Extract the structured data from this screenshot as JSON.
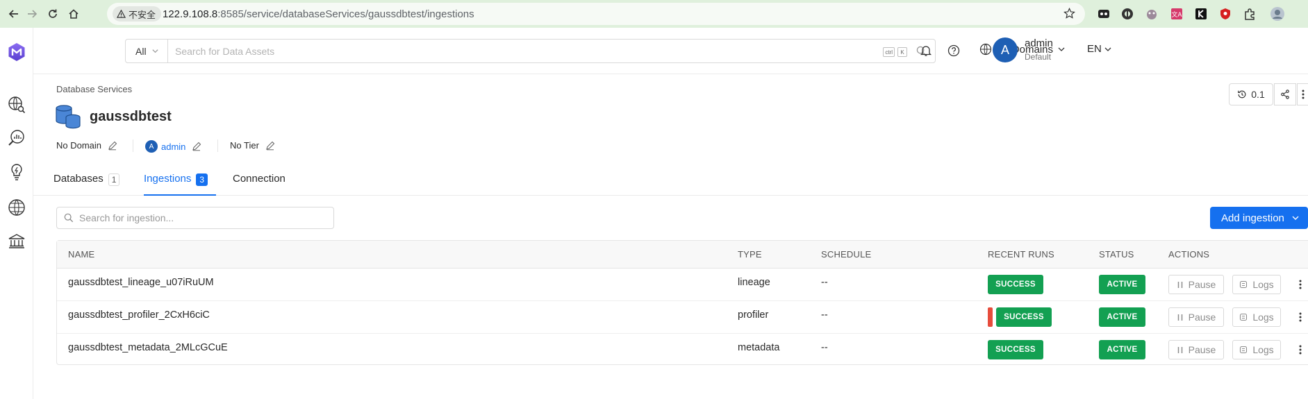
{
  "browser": {
    "insecure_label": "不安全",
    "url_host": "122.9.108.8",
    "url_rest": ":8585/service/databaseServices/gaussdbtest/ingestions"
  },
  "header": {
    "search_scope": "All",
    "search_placeholder": "Search for Data Assets",
    "kbd_ctrl": "ctrl",
    "kbd_k": "K",
    "domains_label": "All Domains",
    "language": "EN",
    "avatar_letter": "A",
    "user_name": "admin",
    "user_role": "Default"
  },
  "page": {
    "breadcrumb": "Database Services",
    "title": "gaussdbtest",
    "version": "0.1",
    "domain": "No Domain",
    "owner_initial": "A",
    "owner": "admin",
    "tier": "No Tier"
  },
  "tabs": [
    {
      "label": "Databases",
      "count": "1"
    },
    {
      "label": "Ingestions",
      "count": "3"
    },
    {
      "label": "Connection"
    }
  ],
  "ingestions": {
    "search_placeholder": "Search for ingestion...",
    "add_button": "Add ingestion",
    "columns": [
      "NAME",
      "TYPE",
      "SCHEDULE",
      "RECENT RUNS",
      "STATUS",
      "ACTIONS"
    ],
    "rows": [
      {
        "name": "gaussdbtest_lineage_u07iRuUM",
        "type": "lineage",
        "schedule": "--",
        "recent_run": "SUCCESS",
        "status": "ACTIVE",
        "pause": "Pause",
        "logs": "Logs"
      },
      {
        "name": "gaussdbtest_profiler_2CxH6ciC",
        "type": "profiler",
        "schedule": "--",
        "recent_run": "SUCCESS",
        "status": "ACTIVE",
        "pause": "Pause",
        "logs": "Logs"
      },
      {
        "name": "gaussdbtest_metadata_2MLcGCuE",
        "type": "metadata",
        "schedule": "--",
        "recent_run": "SUCCESS",
        "status": "ACTIVE",
        "pause": "Pause",
        "logs": "Logs"
      }
    ]
  },
  "colors": {
    "accent": "#1570ef",
    "success": "#13a052",
    "failed": "#e74c3c",
    "browser_bar": "#dff0dc"
  },
  "icons": [
    "back-icon",
    "forward-icon",
    "reload-icon",
    "home-icon",
    "warning-icon",
    "star-icon",
    "extensions-icon",
    "app-logo-icon",
    "explore-icon",
    "data-quality-icon",
    "insights-icon",
    "domains-icon",
    "governance-icon",
    "globe-icon",
    "bell-icon",
    "help-icon",
    "database-icon",
    "history-icon",
    "share-icon",
    "more-icon",
    "edit-icon",
    "search-icon",
    "pause-icon",
    "logs-icon"
  ]
}
